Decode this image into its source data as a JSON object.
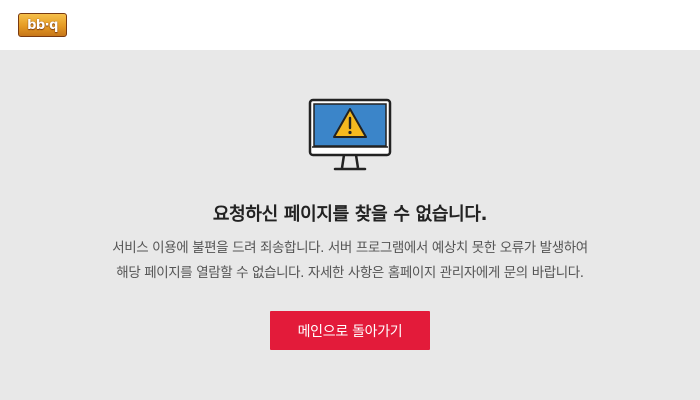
{
  "header": {
    "logo_text": "bb·q"
  },
  "error": {
    "icon": "monitor-warning-icon",
    "title": "요청하신 페이지를 찾을 수 없습니다.",
    "description_lines": [
      "서비스 이용에 불편을 드려 죄송합니다. 서버 프로그램에서 예상치 못한 오류가 발생하여",
      "해당 페이지를 열람할 수 없습니다. 자세한 사항은 홈페이지 관리자에게 문의 바랍니다."
    ],
    "button_label": "메인으로 돌아가기"
  },
  "colors": {
    "page_background": "#e8e8e8",
    "header_background": "#ffffff",
    "button": "#e31b3a",
    "monitor_screen": "#3b85c9",
    "warning": "#f5b91f"
  }
}
